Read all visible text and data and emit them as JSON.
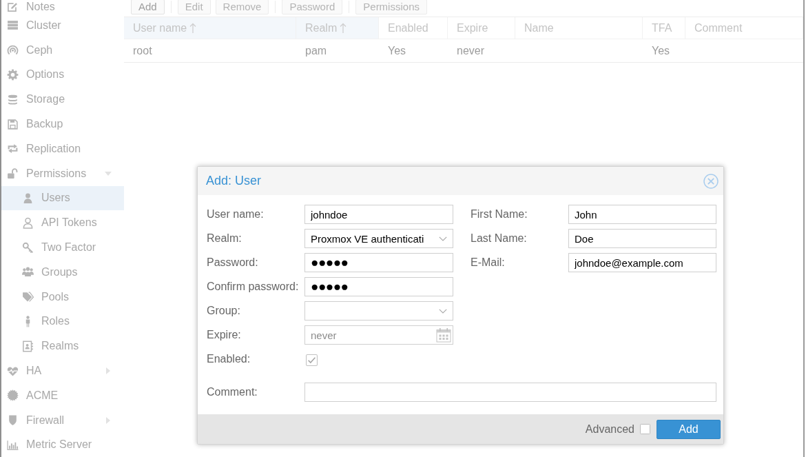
{
  "sidebar": {
    "items": [
      {
        "label": "Notes",
        "selected": false
      },
      {
        "label": "Cluster",
        "selected": false
      },
      {
        "label": "Ceph",
        "selected": false
      },
      {
        "label": "Options",
        "selected": false
      },
      {
        "label": "Storage",
        "selected": false
      },
      {
        "label": "Backup",
        "selected": false
      },
      {
        "label": "Replication",
        "selected": false
      },
      {
        "label": "Permissions",
        "selected": false,
        "expanded": true,
        "children": [
          {
            "label": "Users",
            "selected": true
          },
          {
            "label": "API Tokens",
            "selected": false
          },
          {
            "label": "Two Factor",
            "selected": false
          },
          {
            "label": "Groups",
            "selected": false
          },
          {
            "label": "Pools",
            "selected": false
          },
          {
            "label": "Roles",
            "selected": false
          },
          {
            "label": "Realms",
            "selected": false
          }
        ]
      },
      {
        "label": "HA",
        "selected": false,
        "expanded": false
      },
      {
        "label": "ACME",
        "selected": false
      },
      {
        "label": "Firewall",
        "selected": false,
        "expanded": false
      },
      {
        "label": "Metric Server",
        "selected": false
      }
    ]
  },
  "toolbar": {
    "groups": [
      [
        {
          "label": "Add",
          "disabled": false
        }
      ],
      [
        {
          "label": "Edit",
          "disabled": true
        },
        {
          "label": "Remove",
          "disabled": true
        }
      ],
      [
        {
          "label": "Password",
          "disabled": true
        }
      ],
      [
        {
          "label": "Permissions",
          "disabled": true
        }
      ]
    ]
  },
  "table": {
    "columns": [
      {
        "label": "User name",
        "sorted": true
      },
      {
        "label": "Realm",
        "sorted": true
      },
      {
        "label": "Enabled",
        "sorted": false
      },
      {
        "label": "Expire",
        "sorted": false
      },
      {
        "label": "Name",
        "sorted": false
      },
      {
        "label": "TFA",
        "sorted": false
      },
      {
        "label": "Comment",
        "sorted": false
      }
    ],
    "rows": [
      {
        "user_name": "root",
        "realm": "pam",
        "enabled": "Yes",
        "expire": "never",
        "tfa": "Yes"
      }
    ]
  },
  "dialog": {
    "title": "Add: User",
    "left_fields": [
      {
        "kind": "text",
        "label": "User name:",
        "value": "johndoe"
      },
      {
        "kind": "combo",
        "label": "Realm:",
        "value": "Proxmox VE authenticati"
      },
      {
        "kind": "password",
        "label": "Password:",
        "value": "●●●●●"
      },
      {
        "kind": "password",
        "label": "Confirm password:",
        "value": "●●●●●"
      },
      {
        "kind": "combo",
        "label": "Group:"
      },
      {
        "kind": "date",
        "label": "Expire:",
        "placeholder": "never"
      },
      {
        "kind": "checkbox",
        "label": "Enabled:",
        "checked": true
      }
    ],
    "right_fields": [
      {
        "kind": "text",
        "label": "First Name:",
        "value": "John"
      },
      {
        "kind": "text",
        "label": "Last Name:",
        "value": "Doe"
      },
      {
        "kind": "text",
        "label": "E-Mail:",
        "value": "johndoe@example.com"
      }
    ],
    "comment": {
      "label": "Comment:"
    },
    "footer": {
      "advanced": {
        "label": "Advanced",
        "checked": false
      },
      "buttons": [
        {
          "label": "Add"
        }
      ]
    }
  }
}
